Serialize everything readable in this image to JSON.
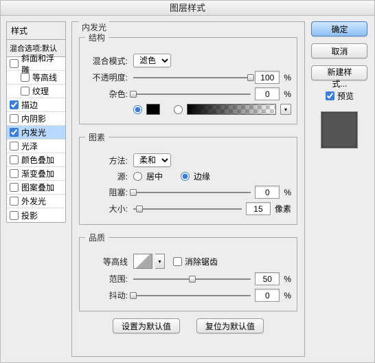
{
  "dialog_title": "图层样式",
  "styles_panel": {
    "header": "样式",
    "blend_options": "混合选项:默认",
    "items": [
      {
        "label": "斜面和浮雕",
        "checked": false,
        "indent": false
      },
      {
        "label": "等高线",
        "checked": false,
        "indent": true
      },
      {
        "label": "纹理",
        "checked": false,
        "indent": true
      },
      {
        "label": "描边",
        "checked": true,
        "indent": false
      },
      {
        "label": "内阴影",
        "checked": false,
        "indent": false
      },
      {
        "label": "内发光",
        "checked": true,
        "indent": false,
        "selected": true
      },
      {
        "label": "光泽",
        "checked": false,
        "indent": false
      },
      {
        "label": "颜色叠加",
        "checked": false,
        "indent": false
      },
      {
        "label": "渐变叠加",
        "checked": false,
        "indent": false
      },
      {
        "label": "图案叠加",
        "checked": false,
        "indent": false
      },
      {
        "label": "外发光",
        "checked": false,
        "indent": false
      },
      {
        "label": "投影",
        "checked": false,
        "indent": false
      }
    ]
  },
  "main_panel": {
    "title": "内发光",
    "structure": {
      "legend": "结构",
      "blend_mode_label": "混合模式:",
      "blend_mode_value": "滤色",
      "opacity_label": "不透明度:",
      "opacity_value": "100",
      "opacity_unit": "%",
      "noise_label": "杂色:",
      "noise_value": "0",
      "noise_unit": "%",
      "color_mode": "solid",
      "solid_color": "#000000"
    },
    "elements": {
      "legend": "图素",
      "technique_label": "方法:",
      "technique_value": "柔和",
      "source_label": "源:",
      "source_center": "居中",
      "source_edge": "边缘",
      "source_value": "edge",
      "choke_label": "阻塞:",
      "choke_value": "0",
      "choke_unit": "%",
      "size_label": "大小:",
      "size_value": "15",
      "size_unit": "像素"
    },
    "quality": {
      "legend": "品质",
      "contour_label": "等高线",
      "antialias_label": "消除锯齿",
      "antialias_checked": false,
      "range_label": "范围:",
      "range_value": "50",
      "range_unit": "%",
      "jitter_label": "抖动:",
      "jitter_value": "0",
      "jitter_unit": "%"
    },
    "buttons": {
      "set_default": "设置为默认值",
      "reset_default": "复位为默认值"
    }
  },
  "right_panel": {
    "ok": "确定",
    "cancel": "取消",
    "new_style": "新建样式...",
    "preview_label": "预览",
    "preview_checked": true
  }
}
